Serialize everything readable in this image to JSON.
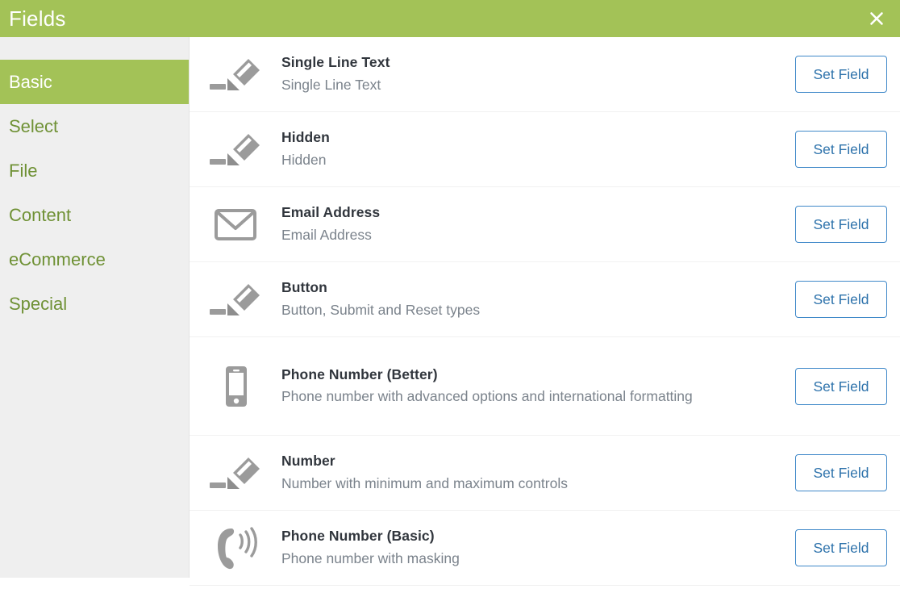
{
  "header": {
    "title": "Fields",
    "close_icon": "close-x-icon",
    "background_color": "#a3c257",
    "title_color": "#ffffff"
  },
  "sidebar": {
    "background_color": "#efefef",
    "active_background_color": "#a3c257",
    "link_color": "#6f9135",
    "items": [
      {
        "label": "Basic",
        "active": true
      },
      {
        "label": "Select",
        "active": false
      },
      {
        "label": "File",
        "active": false
      },
      {
        "label": "Content",
        "active": false
      },
      {
        "label": "eCommerce",
        "active": false
      },
      {
        "label": "Special",
        "active": false
      }
    ]
  },
  "field_list": {
    "action_label": "Set Field",
    "action_border_color": "#4089c9",
    "action_text_color": "#2d72ab",
    "rows": [
      {
        "icon": "pencil-icon",
        "name": "Single Line Text",
        "description": "Single Line Text",
        "button": "Set Field"
      },
      {
        "icon": "pencil-icon",
        "name": "Hidden",
        "description": "Hidden",
        "button": "Set Field"
      },
      {
        "icon": "envelope-icon",
        "name": "Email Address",
        "description": "Email Address",
        "button": "Set Field"
      },
      {
        "icon": "pencil-icon",
        "name": "Button",
        "description": "Button, Submit and Reset types",
        "button": "Set Field"
      },
      {
        "icon": "mobile-phone-icon",
        "name": "Phone Number (Better)",
        "description": "Phone number with advanced options and international formatting",
        "button": "Set Field"
      },
      {
        "icon": "pencil-icon",
        "name": "Number",
        "description": "Number with minimum and maximum controls",
        "button": "Set Field"
      },
      {
        "icon": "phone-ringing-icon",
        "name": "Phone Number (Basic)",
        "description": "Phone number with masking",
        "button": "Set Field"
      }
    ]
  }
}
